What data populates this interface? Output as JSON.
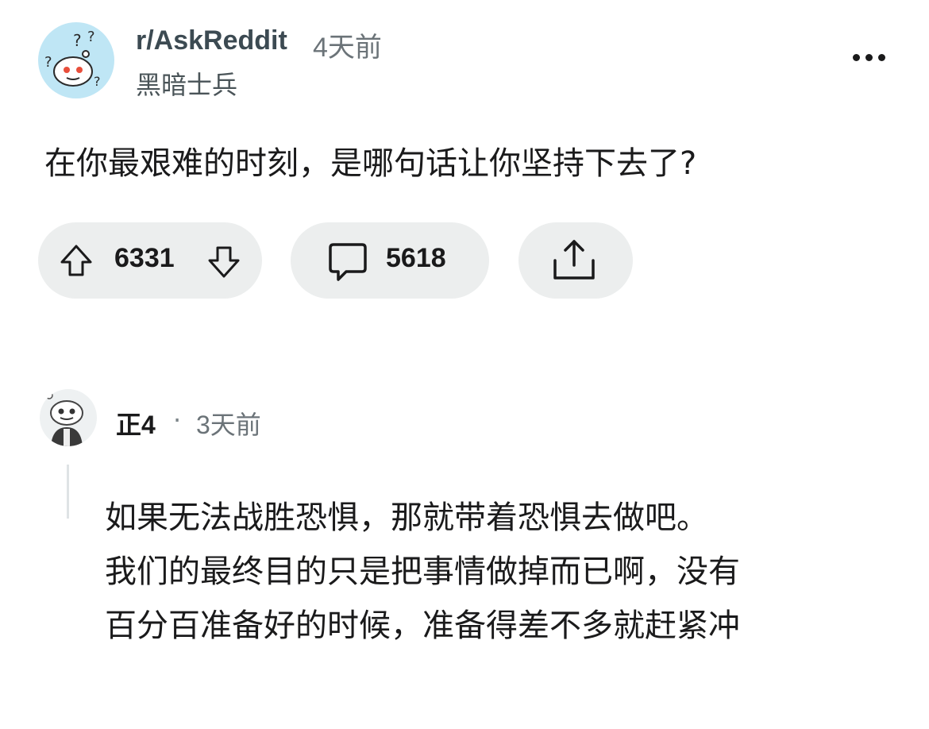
{
  "post": {
    "subreddit": "r/AskReddit",
    "time": "4天前",
    "author": "黑暗士兵",
    "title": "在你最艰难的时刻，是哪句话让你坚持下去了?",
    "upvotes": "6331",
    "comments": "5618"
  },
  "icons": {
    "subreddit_avatar": "reddit-snoo-thinking-icon",
    "more": "more-options-icon",
    "upvote": "upvote-arrow-icon",
    "downvote": "downvote-arrow-icon",
    "comment": "comment-bubble-icon",
    "share": "share-icon",
    "user_avatar": "user-avatar-icon"
  },
  "comment": {
    "user": "正4",
    "separator": "·",
    "time": "3天前",
    "lines": [
      "如果无法战胜恐惧，那就带着恐惧去做吧。",
      "我们的最终目的只是把事情做掉而已啊，没有",
      "百分百准备好的时候，准备得差不多就赶紧冲"
    ]
  }
}
